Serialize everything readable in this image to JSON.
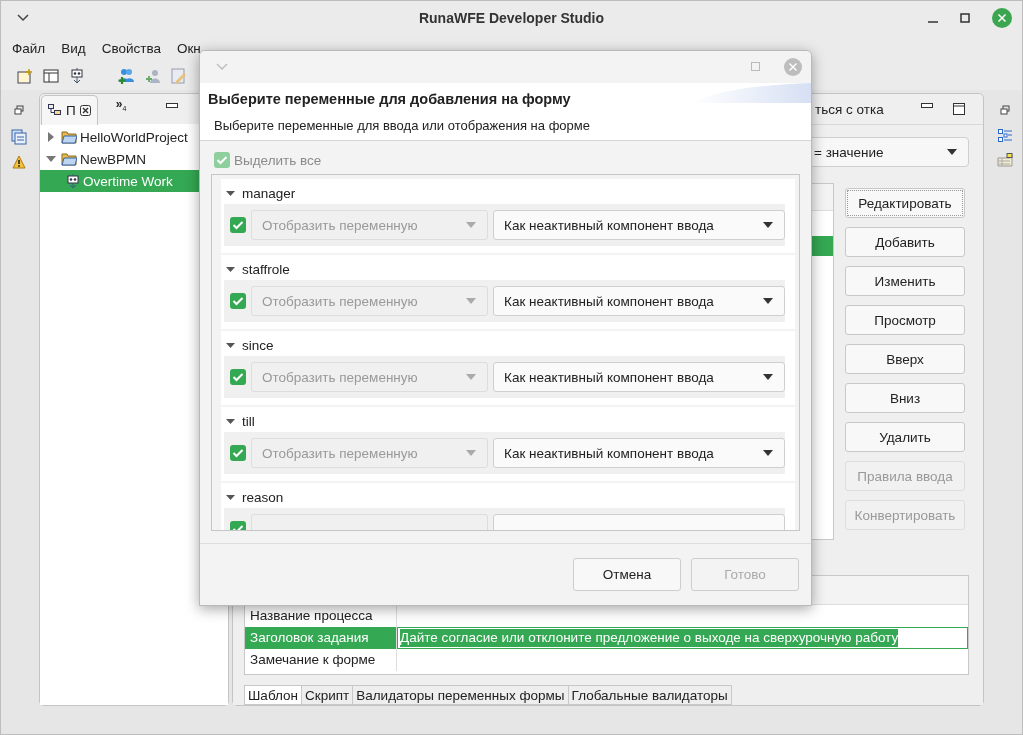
{
  "window": {
    "title": "RunaWFE Developer Studio"
  },
  "menu": [
    {
      "label": "Файл"
    },
    {
      "label": "Вид"
    },
    {
      "label": "Свойства"
    },
    {
      "label": "Окн"
    }
  ],
  "explorer": {
    "tab": {
      "label": "П"
    },
    "overflow": {
      "label": "»",
      "count": "4"
    },
    "tree": [
      {
        "label": "HelloWorldProject",
        "kind": "project",
        "expanded": false,
        "selected": false
      },
      {
        "label": "NewBPMN",
        "kind": "project",
        "expanded": true,
        "selected": false,
        "children": [
          {
            "label": "Overtime Work",
            "kind": "form",
            "selected": true
          }
        ]
      }
    ]
  },
  "editor": {
    "title": "ться с отка",
    "combo": {
      "value": "= значение"
    },
    "buttons": [
      {
        "label": "Редактировать",
        "disabled": false,
        "focused": true
      },
      {
        "label": "Добавить",
        "disabled": false,
        "focused": false
      },
      {
        "label": "Изменить",
        "disabled": false,
        "focused": false
      },
      {
        "label": "Просмотр",
        "disabled": false,
        "focused": false
      },
      {
        "label": "Вверх",
        "disabled": false,
        "focused": false
      },
      {
        "label": "Вниз",
        "disabled": false,
        "focused": false
      },
      {
        "label": "Удалить",
        "disabled": false,
        "focused": false
      },
      {
        "label": "Правила ввода",
        "disabled": true,
        "focused": false
      },
      {
        "label": "Конвертировать",
        "disabled": true,
        "focused": false
      }
    ],
    "properties": [
      {
        "key": "Название процесса",
        "selected": false
      },
      {
        "key": "Заголовок задания",
        "value": "Дайте согласие или отклоните предложение о выходе на сверхурочную работу",
        "selected": true
      },
      {
        "key": "Замечание к форме",
        "selected": false
      }
    ],
    "tabs": [
      {
        "label": "Шаблон",
        "selected": true
      },
      {
        "label": "Скрипт",
        "selected": false
      },
      {
        "label": "Валидаторы переменных формы",
        "selected": false
      },
      {
        "label": "Глобальные валидаторы",
        "selected": false
      }
    ]
  },
  "dialog": {
    "title": "Выберите переменные для добавления на форму",
    "subtitle": "Выберите переменные для ввода или отображения на форме",
    "select_all": {
      "label": "Выделить все",
      "checked": true,
      "disabled": true
    },
    "variables": [
      {
        "name": "manager",
        "expanded": true,
        "checked": true,
        "mode": {
          "value": "Отобразить переменную",
          "disabled": true
        },
        "display": {
          "value": "Как неактивный компонент ввода",
          "disabled": false
        }
      },
      {
        "name": "staffrole",
        "expanded": true,
        "checked": true,
        "mode": {
          "value": "Отобразить переменную",
          "disabled": true
        },
        "display": {
          "value": "Как неактивный компонент ввода",
          "disabled": false
        }
      },
      {
        "name": "since",
        "expanded": true,
        "checked": true,
        "mode": {
          "value": "Отобразить переменную",
          "disabled": true
        },
        "display": {
          "value": "Как неактивный компонент ввода",
          "disabled": false
        }
      },
      {
        "name": "till",
        "expanded": true,
        "checked": true,
        "mode": {
          "value": "Отобразить переменную",
          "disabled": true
        },
        "display": {
          "value": "Как неактивный компонент ввода",
          "disabled": false
        }
      },
      {
        "name": "reason",
        "expanded": true,
        "checked": true
      }
    ],
    "buttons": [
      {
        "label": "Отмена",
        "disabled": false
      },
      {
        "label": "Готово",
        "disabled": true
      }
    ]
  }
}
